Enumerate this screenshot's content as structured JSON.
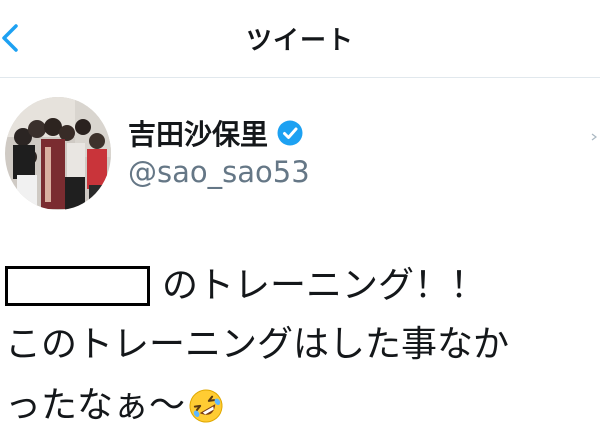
{
  "header": {
    "title": "ツイート",
    "back_icon": "chevron-left-icon"
  },
  "colors": {
    "accent": "#1da1f2",
    "text": "#14171a",
    "secondary_text": "#657786",
    "divider": "#e1e8ed"
  },
  "tweet": {
    "author": {
      "display_name": "吉田沙保里",
      "handle": "@sao_sao53",
      "verified": true,
      "verified_icon": "verified-badge-icon"
    },
    "body": {
      "line1_after_redaction": "のトレーニング！！",
      "line2": "このトレーニングはした事なか",
      "line3": "ったなぁ〜",
      "emoji": "rolling-on-the-floor-laughing-emoji"
    }
  }
}
